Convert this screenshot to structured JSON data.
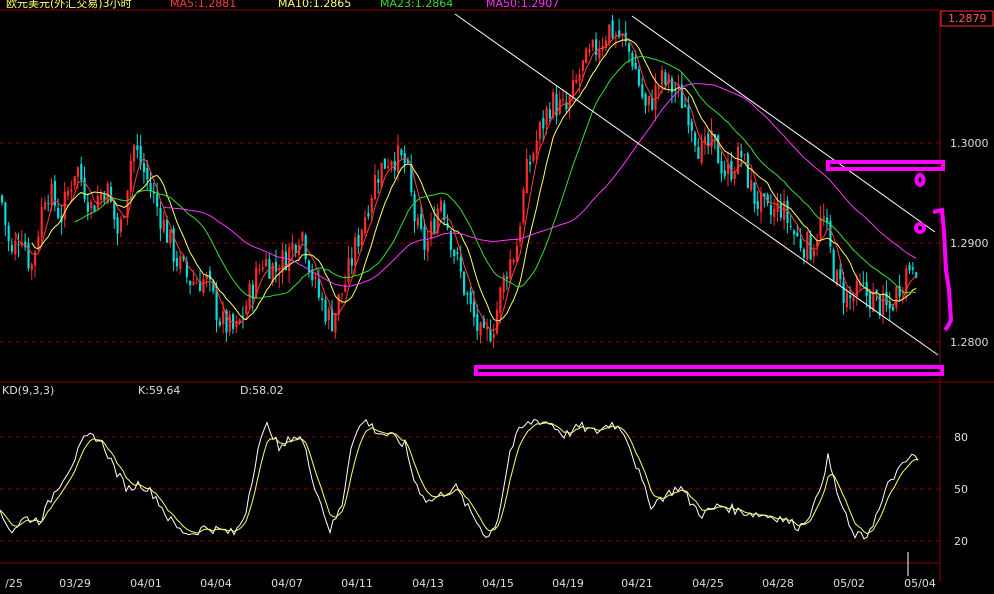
{
  "header": {
    "title": "欧元美元(外汇交易)3小时",
    "ma_labels": [
      {
        "text": "MA5:1.2881",
        "color": "#ff3b3b"
      },
      {
        "text": "MA10:1.2865",
        "color": "#ffff66"
      },
      {
        "text": "MA23:1.2864",
        "color": "#33dd33"
      },
      {
        "text": "MA50:1.2907",
        "color": "#ff33ff"
      }
    ]
  },
  "price_panel": {
    "current_price": "1.2879",
    "price_ticks": [
      "1.3000",
      "1.2900",
      "1.2800"
    ]
  },
  "kd_panel": {
    "label": "KD(9,3,3)",
    "k_label": "K:59.64",
    "d_label": "D:58.02",
    "ticks": [
      "80",
      "50",
      "20"
    ]
  },
  "x_axis": {
    "labels": [
      "/25",
      "03/29",
      "04/01",
      "04/04",
      "04/07",
      "04/11",
      "04/13",
      "04/15",
      "04/19",
      "04/21",
      "04/25",
      "04/28",
      "05/02",
      "05/04"
    ]
  },
  "colors": {
    "background": "#000000",
    "up_candle": "#ff2a2a",
    "down_candle": "#00dcdc",
    "ma5": "#ff3b3b",
    "ma10": "#ffff66",
    "ma23": "#33dd33",
    "ma50": "#ff33ff",
    "k_line": "#ffffff",
    "d_line": "#ffff66",
    "grid": "#8b0000",
    "annotation": "#ff00ff",
    "axis_text": "#dddddd"
  },
  "chart_data": {
    "type": "candlestick",
    "series": [
      {
        "name": "MA5",
        "values": [
          1.2881
        ]
      },
      {
        "name": "MA10",
        "values": [
          1.2865
        ]
      },
      {
        "name": "MA23",
        "values": [
          1.2864
        ]
      },
      {
        "name": "MA50",
        "values": [
          1.2907
        ]
      }
    ],
    "price_ylim": [
      1.2775,
      1.3125
    ],
    "kd_ylim": [
      0,
      100
    ],
    "price_anchors": [
      [
        0,
        1.295
      ],
      [
        10,
        1.289
      ],
      [
        20,
        1.292
      ],
      [
        30,
        1.288
      ],
      [
        45,
        1.296
      ],
      [
        60,
        1.293
      ],
      [
        75,
        1.298
      ],
      [
        90,
        1.294
      ],
      [
        105,
        1.296
      ],
      [
        118,
        1.291
      ],
      [
        132,
        1.3
      ],
      [
        148,
        1.296
      ],
      [
        160,
        1.293
      ],
      [
        175,
        1.289
      ],
      [
        188,
        1.287
      ],
      [
        205,
        1.287
      ],
      [
        220,
        1.283
      ],
      [
        235,
        1.282
      ],
      [
        250,
        1.286
      ],
      [
        262,
        1.289
      ],
      [
        275,
        1.288
      ],
      [
        290,
        1.29
      ],
      [
        300,
        1.292
      ],
      [
        315,
        1.286
      ],
      [
        330,
        1.283
      ],
      [
        345,
        1.287
      ],
      [
        360,
        1.292
      ],
      [
        375,
        1.297
      ],
      [
        390,
        1.299
      ],
      [
        405,
        1.298
      ],
      [
        415,
        1.292
      ],
      [
        425,
        1.29
      ],
      [
        440,
        1.295
      ],
      [
        455,
        1.289
      ],
      [
        470,
        1.284
      ],
      [
        482,
        1.281
      ],
      [
        493,
        1.283
      ],
      [
        505,
        1.288
      ],
      [
        515,
        1.29
      ],
      [
        525,
        1.297
      ],
      [
        538,
        1.301
      ],
      [
        550,
        1.304
      ],
      [
        565,
        1.303
      ],
      [
        580,
        1.307
      ],
      [
        595,
        1.309
      ],
      [
        608,
        1.311
      ],
      [
        620,
        1.31
      ],
      [
        632,
        1.308
      ],
      [
        645,
        1.303
      ],
      [
        660,
        1.306
      ],
      [
        675,
        1.305
      ],
      [
        688,
        1.303
      ],
      [
        700,
        1.299
      ],
      [
        712,
        1.3
      ],
      [
        725,
        1.297
      ],
      [
        740,
        1.299
      ],
      [
        752,
        1.295
      ],
      [
        768,
        1.293
      ],
      [
        780,
        1.294
      ],
      [
        795,
        1.291
      ],
      [
        810,
        1.29
      ],
      [
        822,
        1.293
      ],
      [
        835,
        1.287
      ],
      [
        848,
        1.285
      ],
      [
        860,
        1.286
      ],
      [
        875,
        1.285
      ],
      [
        888,
        1.284
      ],
      [
        900,
        1.287
      ],
      [
        912,
        1.289
      ],
      [
        920,
        1.288
      ]
    ],
    "kd_anchors": [
      [
        0,
        30
      ],
      [
        12,
        20
      ],
      [
        25,
        28
      ],
      [
        40,
        26
      ],
      [
        55,
        45
      ],
      [
        70,
        60
      ],
      [
        85,
        78
      ],
      [
        95,
        80
      ],
      [
        105,
        72
      ],
      [
        118,
        55
      ],
      [
        128,
        46
      ],
      [
        140,
        50
      ],
      [
        155,
        42
      ],
      [
        168,
        28
      ],
      [
        180,
        20
      ],
      [
        192,
        18
      ],
      [
        205,
        22
      ],
      [
        220,
        20
      ],
      [
        235,
        18
      ],
      [
        245,
        30
      ],
      [
        258,
        72
      ],
      [
        268,
        88
      ],
      [
        280,
        70
      ],
      [
        292,
        80
      ],
      [
        302,
        78
      ],
      [
        315,
        48
      ],
      [
        330,
        20
      ],
      [
        342,
        36
      ],
      [
        352,
        78
      ],
      [
        365,
        90
      ],
      [
        378,
        82
      ],
      [
        390,
        80
      ],
      [
        405,
        74
      ],
      [
        415,
        50
      ],
      [
        428,
        38
      ],
      [
        440,
        42
      ],
      [
        455,
        48
      ],
      [
        470,
        32
      ],
      [
        488,
        15
      ],
      [
        498,
        28
      ],
      [
        510,
        70
      ],
      [
        520,
        84
      ],
      [
        535,
        90
      ],
      [
        550,
        88
      ],
      [
        565,
        80
      ],
      [
        580,
        86
      ],
      [
        595,
        82
      ],
      [
        612,
        88
      ],
      [
        625,
        82
      ],
      [
        638,
        58
      ],
      [
        650,
        36
      ],
      [
        665,
        42
      ],
      [
        680,
        48
      ],
      [
        690,
        38
      ],
      [
        702,
        30
      ],
      [
        720,
        36
      ],
      [
        740,
        32
      ],
      [
        760,
        30
      ],
      [
        780,
        28
      ],
      [
        800,
        22
      ],
      [
        815,
        36
      ],
      [
        828,
        66
      ],
      [
        838,
        42
      ],
      [
        852,
        18
      ],
      [
        865,
        15
      ],
      [
        880,
        34
      ],
      [
        890,
        52
      ],
      [
        902,
        60
      ],
      [
        912,
        68
      ],
      [
        920,
        62
      ]
    ]
  }
}
